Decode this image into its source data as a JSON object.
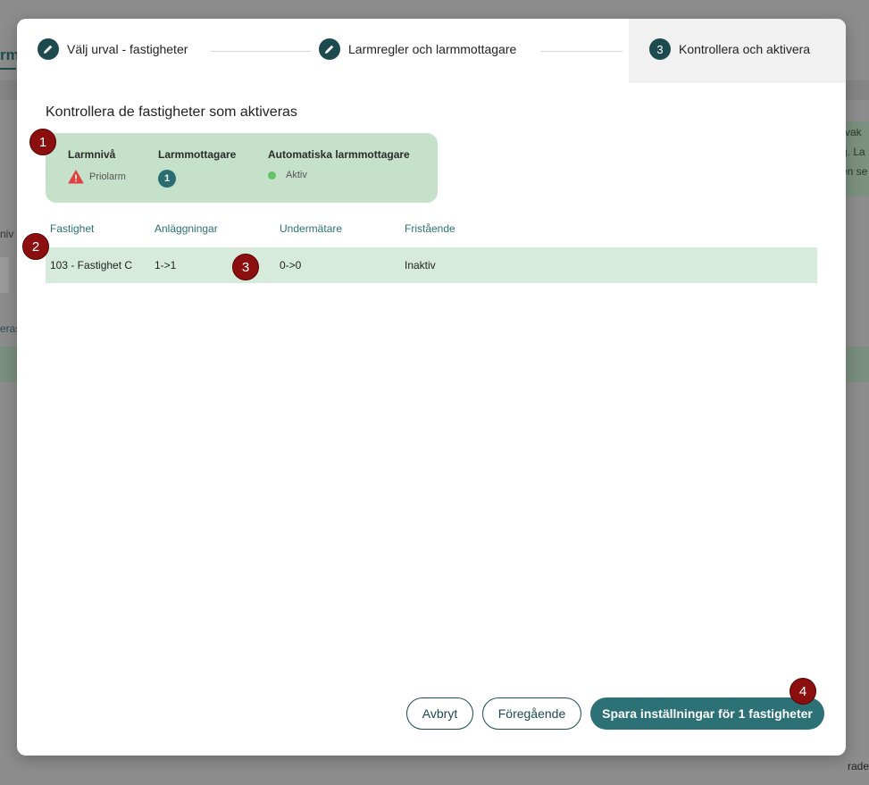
{
  "background": {
    "tab_label": "rm",
    "left_text_1": "niv",
    "left_text_2": "eras",
    "right_text_lines": [
      "rvak",
      "g. La",
      "en se"
    ],
    "bottom_right_text": "rade"
  },
  "stepper": {
    "steps": [
      {
        "label": "Välj urval - fastigheter",
        "icon": "pencil-icon"
      },
      {
        "label": "Larmregler och larmmottagare",
        "icon": "pencil-icon"
      },
      {
        "label": "Kontrollera och aktivera",
        "number": "3"
      }
    ]
  },
  "heading": "Kontrollera de fastigheter som aktiveras",
  "summary": {
    "alarm_level_label": "Larmnivå",
    "alarm_level_value": "Priolarm",
    "alarm_level_icon": "warning-icon",
    "receivers_label": "Larmmottagare",
    "receivers_count": "1",
    "auto_receivers_label": "Automatiska larmmottagare",
    "auto_receivers_status": "Aktiv"
  },
  "table": {
    "columns": [
      "Fastighet",
      "Anläggningar",
      "Undermätare",
      "Fristående"
    ],
    "rows": [
      {
        "fastighet": "103 - Fastighet C",
        "anlaggningar": "1->1",
        "undermatare": "0->0",
        "fristaende": "Inaktiv"
      }
    ]
  },
  "footer": {
    "cancel_label": "Avbryt",
    "previous_label": "Föregående",
    "save_label": "Spara inställningar för 1 fastigheter"
  },
  "markers": [
    "1",
    "2",
    "3",
    "4"
  ],
  "colors": {
    "accent": "#2b7176",
    "dark": "#1d4a4f",
    "summary_bg": "#c5e1ca",
    "row_bg": "#d6ebdb",
    "marker": "#8b0f0f",
    "warning": "#e04040",
    "status_active": "#66c266"
  }
}
